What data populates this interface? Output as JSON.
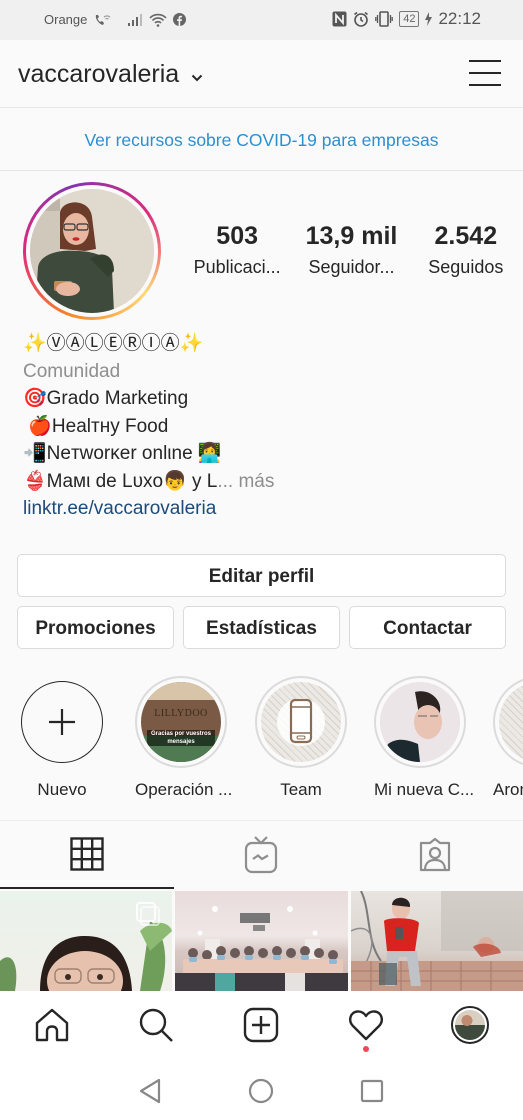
{
  "status_bar": {
    "carrier": "Orange",
    "battery": "42",
    "time": "22:12",
    "icons": [
      "wifi-call-icon",
      "signal-icon",
      "wifi-icon",
      "facebook-icon",
      "nfc-icon",
      "alarm-icon",
      "vibrate-icon",
      "battery-icon",
      "charging-icon"
    ]
  },
  "header": {
    "username": "vaccarovaleria",
    "account_switch_icon": "chevron-down-icon",
    "menu_icon": "hamburger-menu-icon"
  },
  "banner": {
    "covid_link": "Ver recursos sobre COVID-19 para empresas"
  },
  "profile": {
    "stats": [
      {
        "value": "503",
        "label": "Publicaci..."
      },
      {
        "value": "13,9 mil",
        "label": "Seguidor..."
      },
      {
        "value": "2.542",
        "label": "Seguidos"
      }
    ],
    "name": "✨ⓋⒶⓁⒺⓇⒾⒶ✨",
    "category": "Comunidad",
    "bio_lines": [
      "🎯Grado Marketing",
      " 🍎Healтнy Food",
      "📲Neтworĸer onlιne 👩‍💻",
      "👙Maмι de Lυxo👦 y L"
    ],
    "more_label": "... más",
    "link": "linktr.ee/vaccarovaleria"
  },
  "actions": {
    "edit_profile": "Editar perfil",
    "promotions": "Promociones",
    "insights": "Estadísticas",
    "contact": "Contactar"
  },
  "highlights": [
    {
      "label": "Nuevo",
      "type": "new"
    },
    {
      "label": "Operación ...",
      "overlay_brand": "LILLYDOO",
      "overlay_caption": "Gracias por vuestros mensajes"
    },
    {
      "label": "Team"
    },
    {
      "label": "Mi nueva C..."
    },
    {
      "label": "Arom"
    }
  ],
  "tabs": [
    {
      "name": "grid",
      "icon": "grid-icon",
      "active": true
    },
    {
      "name": "igtv",
      "icon": "igtv-icon",
      "active": false
    },
    {
      "name": "tagged",
      "icon": "tagged-user-icon",
      "active": false
    }
  ],
  "bottom_nav": [
    {
      "name": "home",
      "icon": "home-icon"
    },
    {
      "name": "search",
      "icon": "search-icon"
    },
    {
      "name": "new-post",
      "icon": "add-post-icon"
    },
    {
      "name": "activity",
      "icon": "heart-icon",
      "notification_dot": true
    },
    {
      "name": "profile",
      "icon": "profile-avatar-icon"
    }
  ],
  "system_nav": [
    {
      "name": "back",
      "icon": "back-triangle-icon"
    },
    {
      "name": "home",
      "icon": "home-circle-icon"
    },
    {
      "name": "recents",
      "icon": "recents-square-icon"
    }
  ],
  "colors": {
    "link_blue": "#2c8fce",
    "text": "#262626",
    "muted": "#8e8e8e",
    "notification": "#ed4956"
  }
}
